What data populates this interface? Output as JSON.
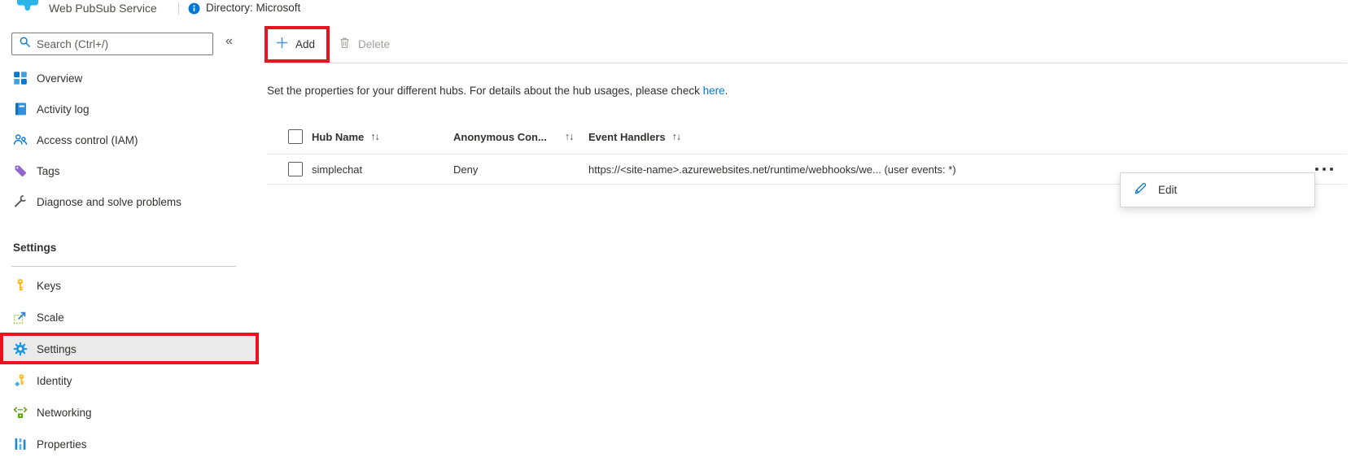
{
  "header": {
    "service_title": "Web PubSub Service",
    "directory_label": "Directory: Microsoft"
  },
  "sidebar": {
    "search_placeholder": "Search (Ctrl+/)",
    "collapse_glyph": "«",
    "items": [
      {
        "label": "Overview",
        "icon": "overview-icon"
      },
      {
        "label": "Activity log",
        "icon": "activity-log-icon"
      },
      {
        "label": "Access control (IAM)",
        "icon": "access-control-icon"
      },
      {
        "label": "Tags",
        "icon": "tag-icon"
      },
      {
        "label": "Diagnose and solve problems",
        "icon": "wrench-icon"
      }
    ],
    "settings_group": {
      "header": "Settings",
      "items": [
        {
          "label": "Keys",
          "icon": "key-icon",
          "selected": false
        },
        {
          "label": "Scale",
          "icon": "scale-icon",
          "selected": false
        },
        {
          "label": "Settings",
          "icon": "gear-icon",
          "selected": true,
          "annotated": true
        },
        {
          "label": "Identity",
          "icon": "identity-icon",
          "selected": false
        },
        {
          "label": "Networking",
          "icon": "networking-icon",
          "selected": false
        },
        {
          "label": "Properties",
          "icon": "properties-icon",
          "selected": false
        }
      ]
    }
  },
  "toolbar": {
    "add_label": "Add",
    "delete_label": "Delete",
    "add_annotated": true,
    "delete_disabled": true
  },
  "description": {
    "text_before_link": "Set the properties for your different hubs. For details about the hub usages, please check ",
    "link_text": "here",
    "text_after_link": "."
  },
  "table": {
    "sort_glyph": "↑↓",
    "columns": [
      {
        "label": "Hub Name",
        "sortable": true
      },
      {
        "label": "Anonymous Con...",
        "sortable": true
      },
      {
        "label": "Event Handlers",
        "sortable": true
      }
    ],
    "rows": [
      {
        "hub_name": "simplechat",
        "anonymous_connect": "Deny",
        "event_handlers": "https://<site-name>.azurewebsites.net/runtime/webhooks/we... (user events: *)"
      }
    ]
  },
  "context_menu": {
    "items": [
      {
        "label": "Edit",
        "icon": "pencil-icon"
      }
    ]
  },
  "colors": {
    "accent_blue": "#0078d4",
    "annotation_red": "#e9121e",
    "selected_item_bg": "#eaeaea",
    "disabled_gray": "#a19f9d",
    "logo_cyan": "#29b5e8"
  }
}
